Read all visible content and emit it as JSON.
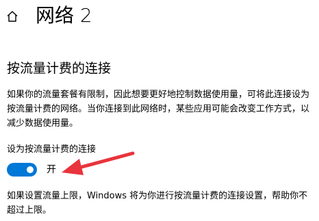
{
  "header": {
    "home_icon": "home-icon",
    "title": "网络 2"
  },
  "metered": {
    "heading": "按流量计费的连接",
    "description": "如果你的流量套餐有限制，因此想要更好地控制数据使用量，可将此连接设为按流量计费的网络。当你连接到此网络时，某些应用可能会改变工作方式，以减少数据使用量。",
    "toggle_label": "设为按流量计费的连接",
    "toggle_state": "开",
    "toggle_on": true,
    "footnote": "如果设置流量上限，Windows 将为你进行按流量计费的连接设置，帮助你不超过上限。"
  },
  "colors": {
    "accent": "#0078d7",
    "annotation_arrow": "#e8343c"
  }
}
